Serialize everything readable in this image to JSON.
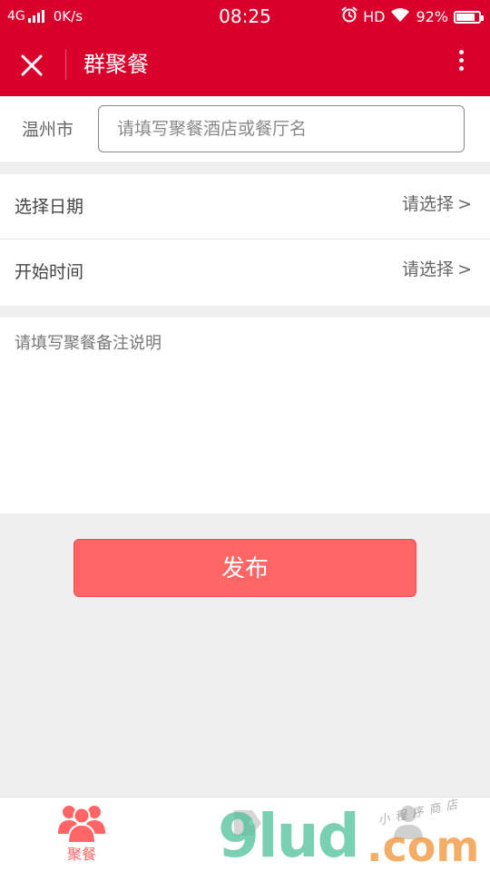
{
  "status_bar": {
    "network": "4G",
    "speed": "0K/s",
    "time": "08:25",
    "hd": "HD",
    "battery_text": "92%",
    "battery_level": 0.92
  },
  "app_bar": {
    "title": "群聚餐",
    "close_icon": "close-icon",
    "more_icon": "more-vertical-icon"
  },
  "location": {
    "city": "温州市"
  },
  "search": {
    "placeholder": "请填写聚餐酒店或餐厅名",
    "value": ""
  },
  "form": {
    "rows": [
      {
        "label": "选择日期",
        "value": "请选择",
        "chevron": ">"
      },
      {
        "label": "开始时间",
        "value": "请选择",
        "chevron": ">"
      }
    ]
  },
  "notes": {
    "placeholder": "请填写聚餐备注说明",
    "value": ""
  },
  "publish": {
    "label": "发布"
  },
  "bottom_nav": {
    "items": [
      {
        "label": "聚餐",
        "icon": "people-group-icon",
        "active": true
      },
      {
        "label": "",
        "icon": "tag-icon",
        "active": false
      },
      {
        "label": "",
        "icon": "user-icon",
        "active": false
      }
    ]
  },
  "watermark": {
    "brand": "9lud",
    "suffix": ".com",
    "shop_text": "小程序商店"
  },
  "colors": {
    "primary": "#d9002c",
    "button": "#ff6565",
    "background": "#efefef"
  }
}
